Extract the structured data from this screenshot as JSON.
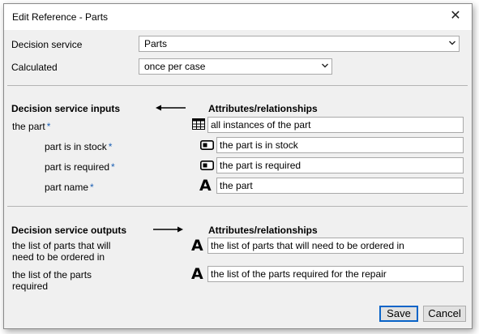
{
  "window": {
    "title": "Edit Reference - Parts",
    "close_glyph": "✕"
  },
  "form": {
    "decision_service_label": "Decision service",
    "decision_service_value": "Parts",
    "calculated_label": "Calculated",
    "calculated_value": "once per case"
  },
  "inputs": {
    "header": "Decision service inputs",
    "attr_header": "Attributes/relationships",
    "rows": [
      {
        "label": "the part",
        "value": "all instances of the part",
        "icon": "table-icon"
      },
      {
        "label": "part is in stock",
        "value": "the part is in stock",
        "icon": "boolean-icon"
      },
      {
        "label": "part is required",
        "value": "the part is required",
        "icon": "boolean-icon"
      },
      {
        "label": "part name",
        "value": "the part",
        "icon": "text-icon"
      }
    ]
  },
  "outputs": {
    "header": "Decision service outputs",
    "attr_header": "Attributes/relationships",
    "rows": [
      {
        "label": "the list of parts that will need to be ordered in",
        "value": "the list of parts that will need to be ordered in",
        "icon": "text-icon"
      },
      {
        "label": "the list of the parts required",
        "value": "the list of the parts required for the repair",
        "icon": "text-icon"
      }
    ]
  },
  "glyphs": {
    "required": "*",
    "text_icon": "A"
  },
  "buttons": {
    "save": "Save",
    "cancel": "Cancel"
  },
  "colors": {
    "required_marker": "#1a5fb4",
    "default_button_border": "#0a64c8"
  }
}
